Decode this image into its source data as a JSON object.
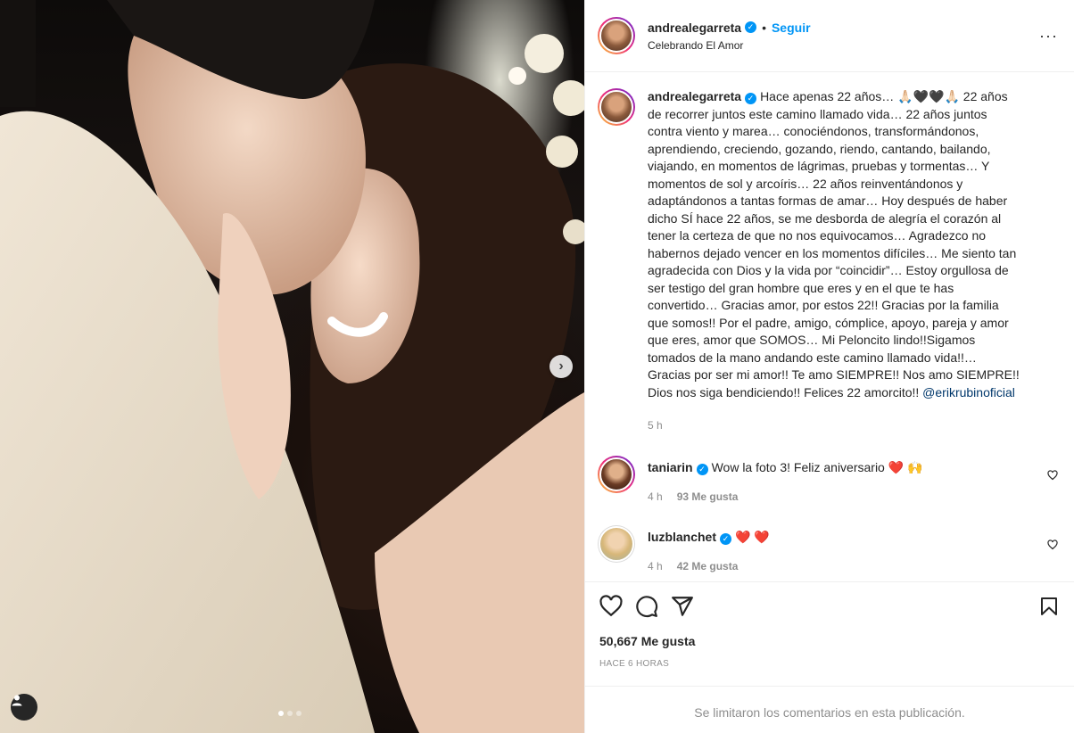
{
  "post": {
    "username": "andrealegarreta",
    "location": "Celebrando El Amor",
    "follow_label": "Seguir",
    "bullet": "•",
    "more_label": "···",
    "nav_next": "›",
    "image_count": 3,
    "current_image": 1
  },
  "caption": {
    "username": "andrealegarreta",
    "text": "Hace apenas 22 años… 🙏🏻🖤🖤🙏🏻 22 años de recorrer juntos este camino llamado vida… 22 años juntos contra viento y marea… conociéndonos, transformándonos, aprendiendo, creciendo, gozando, riendo, cantando, bailando, viajando, en momentos de lágrimas, pruebas y tormentas… Y momentos de sol y arcoíris… 22 años reinventándonos y adaptándonos a tantas formas de amar… Hoy después de haber dicho SÍ hace 22 años, se me desborda de alegría el corazón al tener la certeza de que no nos equivocamos… Agradezco no habernos dejado vencer en los momentos difíciles… Me siento tan agradecida con Dios y la vida por “coincidir”… Estoy orgullosa de ser testigo del gran hombre que eres y en el que te has convertido… Gracias amor, por estos 22!! Gracias por la familia que somos!! Por el padre, amigo, cómplice, apoyo, pareja y amor que eres, amor que SOMOS… Mi Peloncito lindo!!Sigamos tomados de la mano andando este camino llamado vida!!… Gracias por ser mi amor!! Te amo SIEMPRE!! Nos amo SIEMPRE!! Dios nos siga bendiciendo!! Felices 22 amorcito!!",
    "mention": "@erikrubinoficial",
    "time": "5 h"
  },
  "comments": [
    {
      "username": "taniarin",
      "text": "Wow la foto 3! Feliz aniversario ❤️ 🙌",
      "time": "4 h",
      "likes": "93 Me gusta"
    },
    {
      "username": "luzblanchet",
      "text": "❤️ ❤️",
      "time": "4 h",
      "likes": "42 Me gusta"
    }
  ],
  "footer": {
    "likes": "50,667 Me gusta",
    "time": "HACE 6 HORAS",
    "limited": "Se limitaron los comentarios en esta publicación."
  },
  "colors": {
    "accent": "#0095f6",
    "heart": "#ed4956",
    "muted": "#8e8e8e"
  },
  "icons": [
    "heart-icon",
    "comment-icon",
    "share-icon",
    "bookmark-icon",
    "more-icon",
    "user-tag-icon",
    "verified-icon"
  ]
}
